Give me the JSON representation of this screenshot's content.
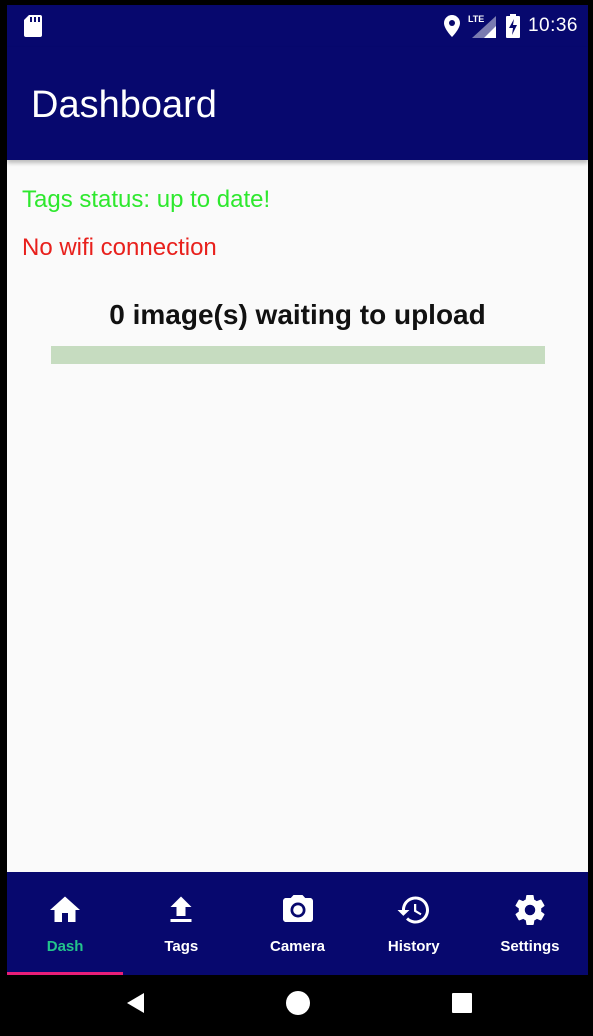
{
  "status_bar": {
    "network_label": "LTE",
    "time": "10:36",
    "icons": [
      "sd-card-icon",
      "location-icon",
      "signal-icon",
      "battery-charging-icon"
    ]
  },
  "app_bar": {
    "title": "Dashboard"
  },
  "dashboard": {
    "tags_status": "Tags status: up to date!",
    "tags_status_color": "#2ee82e",
    "wifi_status": "No wifi connection",
    "wifi_status_color": "#e8201c",
    "upload_count_text": "0 image(s) waiting to upload",
    "upload_progress_percent": 0
  },
  "bottom_nav": {
    "items": [
      {
        "label": "Dash",
        "icon": "home-icon",
        "active": true
      },
      {
        "label": "Tags",
        "icon": "upload-icon",
        "active": false
      },
      {
        "label": "Camera",
        "icon": "camera-icon",
        "active": false
      },
      {
        "label": "History",
        "icon": "history-icon",
        "active": false
      },
      {
        "label": "Settings",
        "icon": "gear-icon",
        "active": false
      }
    ],
    "active_color": "#23c48c",
    "indicator_color": "#e81e78"
  },
  "system_nav": {
    "icons": [
      "back-icon",
      "home-circle-icon",
      "recents-icon"
    ]
  },
  "colors": {
    "primary": "#07086e",
    "background": "#fafafa",
    "progress_track": "#c6dcc0"
  }
}
